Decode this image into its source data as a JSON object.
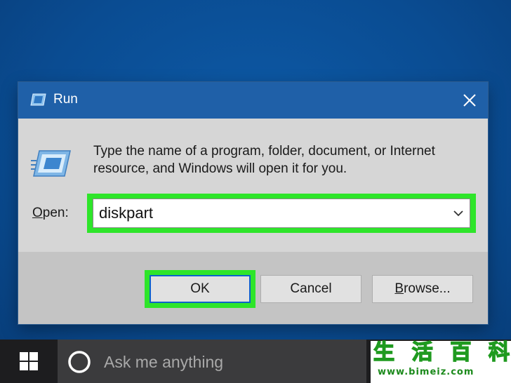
{
  "dialog": {
    "title": "Run",
    "title_icon": "run-icon",
    "close_icon": "close-icon",
    "program_icon": "run-program-icon",
    "description": "Type the name of a program, folder, document, or Internet resource, and Windows will open it for you.",
    "open_label_accel": "O",
    "open_label_rest": "pen:",
    "open_value": "diskpart",
    "chevron_icon": "chevron-down-icon",
    "buttons": {
      "ok": "OK",
      "cancel": "Cancel",
      "browse_accel": "B",
      "browse_rest": "rowse..."
    }
  },
  "taskbar": {
    "start_icon": "windows-logo-icon",
    "search_icon": "cortana-icon",
    "search_placeholder": "Ask me anything"
  },
  "watermark": {
    "chars": [
      "生",
      "活",
      "百",
      "科"
    ],
    "url": "www.bimeiz.com"
  },
  "colors": {
    "desktop": "#0a4c92",
    "titlebar": "#1f60a8",
    "highlight": "#2ee52a",
    "taskbar": "#1d1d1f",
    "search_box": "#3b3b3d",
    "watermark_green": "#1f9a1f"
  }
}
